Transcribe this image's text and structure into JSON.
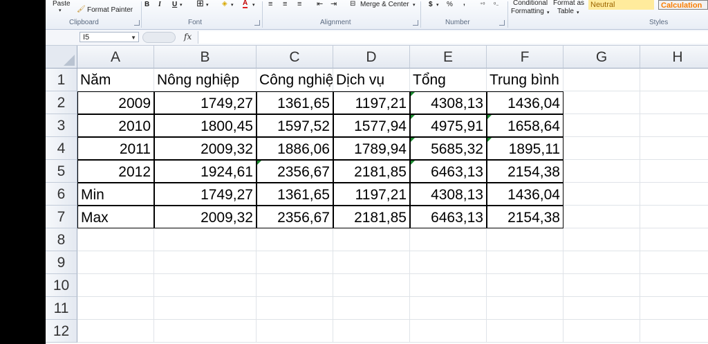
{
  "ribbon": {
    "clipboard": {
      "paste": "Paste",
      "format_painter": "Format Painter",
      "label": "Clipboard"
    },
    "font": {
      "bold": "B",
      "italic": "I",
      "underline": "U",
      "font_color_glyph": "A",
      "label": "Font"
    },
    "alignment": {
      "merge_center": "Merge & Center",
      "label": "Alignment"
    },
    "number": {
      "currency": "$",
      "percent": "%",
      "comma": ",",
      "label": "Number"
    },
    "styles": {
      "conditional_formatting_1": "Conditional",
      "conditional_formatting_2": "Formatting",
      "format_as_table_1": "Format as",
      "format_as_table_2": "Table",
      "neutral": "Neutral",
      "calculation": "Calculation",
      "label": "Styles",
      "neutral_bg": "#ffeb9c",
      "calculation_bg": "#f2f2f2",
      "calculation_color": "#fa7d00"
    }
  },
  "formula_bar": {
    "name_box": "I5",
    "fx": "fx",
    "content": ""
  },
  "columns": [
    "A",
    "B",
    "C",
    "D",
    "E",
    "F",
    "G",
    "H"
  ],
  "rows": [
    "1",
    "2",
    "3",
    "4",
    "5",
    "6",
    "7",
    "8",
    "9",
    "10",
    "11",
    "12"
  ],
  "table": {
    "headers": [
      "Năm",
      "Nông nghiệp",
      "Công nghiệ",
      "Dịch vụ",
      "Tổng",
      "Trung bình"
    ],
    "data": [
      [
        "2009",
        "1749,27",
        "1361,65",
        "1197,21",
        "4308,13",
        "1436,04"
      ],
      [
        "2010",
        "1800,45",
        "1597,52",
        "1577,94",
        "4975,91",
        "1658,64"
      ],
      [
        "2011",
        "2009,32",
        "1886,06",
        "1789,94",
        "5685,32",
        "1895,11"
      ],
      [
        "2012",
        "1924,61",
        "2356,67",
        "2181,85",
        "6463,13",
        "2154,38"
      ],
      [
        "Min",
        "1749,27",
        "1361,65",
        "1197,21",
        "4308,13",
        "1436,04"
      ],
      [
        "Max",
        "2009,32",
        "2356,67",
        "2181,85",
        "6463,13",
        "2154,38"
      ]
    ]
  }
}
